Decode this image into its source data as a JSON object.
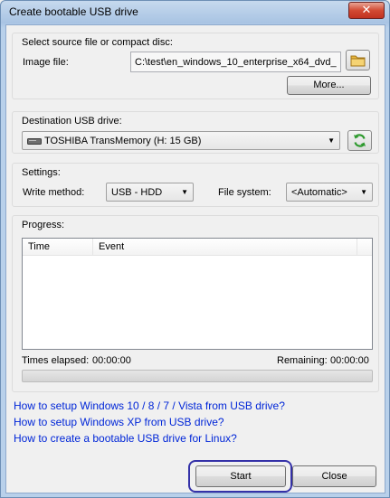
{
  "window": {
    "title": "Create bootable USB drive",
    "close_glyph": "✕"
  },
  "source": {
    "group_label": "Select source file or compact disc:",
    "image_label": "Image file:",
    "image_value": "C:\\test\\en_windows_10_enterprise_x64_dvd_",
    "browse_icon": "folder-icon",
    "more_label": "More..."
  },
  "destination": {
    "group_label": "Destination USB drive:",
    "drive_icon": "usb-drive-icon",
    "drive_value": "TOSHIBA TransMemory (H: 15 GB)",
    "refresh_icon": "refresh-icon"
  },
  "settings": {
    "group_label": "Settings:",
    "write_method_label": "Write method:",
    "write_method_value": "USB - HDD",
    "file_system_label": "File system:",
    "file_system_value": "<Automatic>"
  },
  "progress": {
    "group_label": "Progress:",
    "columns": [
      "Time",
      "Event"
    ],
    "elapsed_label": "Times elapsed:",
    "elapsed_value": "00:00:00",
    "remaining_label": "Remaining:",
    "remaining_value": "00:00:00",
    "progress_fraction": 0
  },
  "links": [
    "How to setup Windows 10 / 8 / 7 / Vista from USB drive?",
    "How to setup Windows XP from USB drive?",
    "How to create a bootable USB drive for Linux?"
  ],
  "buttons": {
    "start": "Start",
    "close": "Close"
  },
  "colors": {
    "link": "#0026d8",
    "focus": "#3431a8",
    "close_button": "#d24a33"
  }
}
